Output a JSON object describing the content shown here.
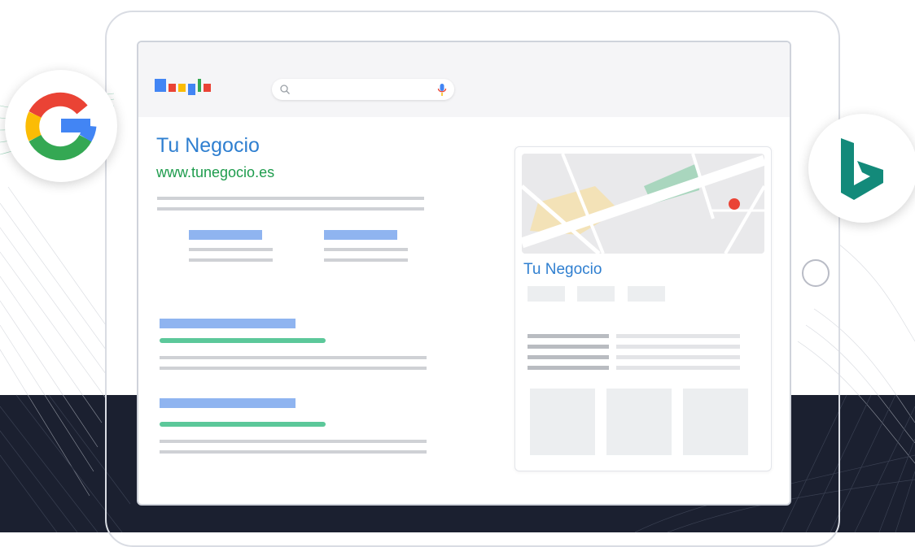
{
  "search": {
    "placeholder": ""
  },
  "result": {
    "title": "Tu Negocio",
    "url": "www.tunegocio.es"
  },
  "knowledge_panel": {
    "title": "Tu Negocio"
  },
  "icons": {
    "google": "google-g-icon",
    "bing": "bing-icon",
    "search": "magnifier-icon",
    "mic": "microphone-icon",
    "map_pin": "map-pin-icon"
  },
  "colors": {
    "link_blue": "#2f7fd0",
    "url_green": "#1e9c4d",
    "dark_band": "#1b2030",
    "bing_teal": "#138a7a"
  }
}
